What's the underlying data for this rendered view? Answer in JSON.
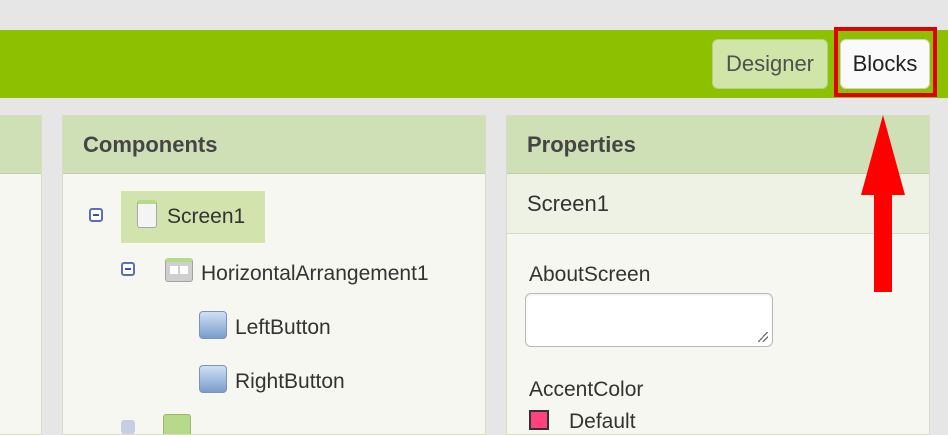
{
  "toolbar": {
    "designer_label": "Designer",
    "blocks_label": "Blocks",
    "highlight_color": "#e00000",
    "background_color": "#8dc100"
  },
  "components_panel": {
    "title": "Components",
    "tree": [
      {
        "label": "Screen1",
        "icon": "screen-icon",
        "selected": true,
        "expanded": true
      },
      {
        "label": "HorizontalArrangement1",
        "icon": "horizontal-arrangement-icon",
        "expanded": true
      },
      {
        "label": "LeftButton",
        "icon": "button-icon"
      },
      {
        "label": "RightButton",
        "icon": "button-icon"
      }
    ]
  },
  "properties_panel": {
    "title": "Properties",
    "component_name": "Screen1",
    "about_screen_label": "AboutScreen",
    "about_screen_value": "",
    "accent_color_label": "AccentColor",
    "accent_color_value": "Default",
    "accent_color_swatch": "#ff4081"
  },
  "annotation": {
    "arrow_color": "#ff0000",
    "arrow_icon": "red-up-arrow"
  }
}
